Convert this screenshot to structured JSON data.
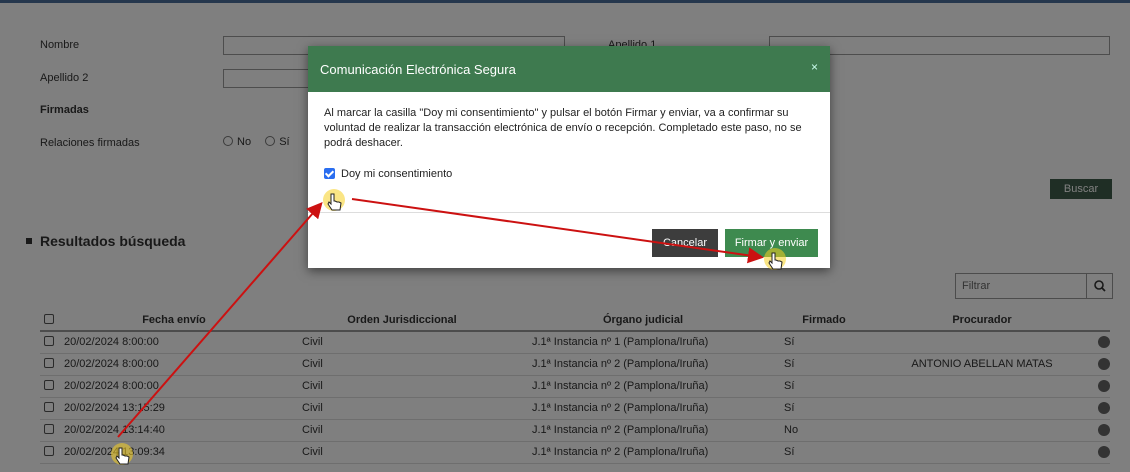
{
  "form": {
    "nombre_label": "Nombre",
    "apellido1_label": "Apellido 1",
    "apellido2_label": "Apellido 2",
    "firmadas_label": "Firmadas",
    "relaciones_label": "Relaciones firmadas",
    "radio_no": "No",
    "radio_si": "Sí",
    "buscar_label": "Buscar"
  },
  "results": {
    "title": "Resultados búsqueda",
    "filter_placeholder": "Filtrar",
    "columns": [
      "Fecha envío",
      "Orden Jurisdiccional",
      "Órgano judicial",
      "Firmado",
      "Procurador"
    ],
    "rows": [
      {
        "fecha": "20/02/2024 8:00:00",
        "orden": "Civil",
        "organo": "J.1ª Instancia nº 1 (Pamplona/Iruña)",
        "firmado": "Sí",
        "procurador": ""
      },
      {
        "fecha": "20/02/2024 8:00:00",
        "orden": "Civil",
        "organo": "J.1ª Instancia nº 2 (Pamplona/Iruña)",
        "firmado": "Sí",
        "procurador": "ANTONIO ABELLAN MATAS"
      },
      {
        "fecha": "20/02/2024 8:00:00",
        "orden": "Civil",
        "organo": "J.1ª Instancia nº 2 (Pamplona/Iruña)",
        "firmado": "Sí",
        "procurador": ""
      },
      {
        "fecha": "20/02/2024 13:15:29",
        "orden": "Civil",
        "organo": "J.1ª Instancia nº 2 (Pamplona/Iruña)",
        "firmado": "Sí",
        "procurador": ""
      },
      {
        "fecha": "20/02/2024 13:14:40",
        "orden": "Civil",
        "organo": "J.1ª Instancia nº 2 (Pamplona/Iruña)",
        "firmado": "No",
        "procurador": ""
      },
      {
        "fecha": "20/02/2024 13:09:34",
        "orden": "Civil",
        "organo": "J.1ª Instancia nº 2 (Pamplona/Iruña)",
        "firmado": "Sí",
        "procurador": ""
      }
    ]
  },
  "modal": {
    "title": "Comunicación Electrónica Segura",
    "close": "×",
    "body": "Al marcar la casilla \"Doy mi consentimiento\" y pulsar el botón Firmar y enviar, va a confirmar su voluntad de realizar la transacción electrónica de envío o recepción. Completado este paso, no se podrá deshacer.",
    "consent_label": "Doy mi consentimiento",
    "consent_checked": true,
    "cancel_label": "Cancelar",
    "submit_label": "Firmar y enviar"
  },
  "colors": {
    "modal_header": "#3e7a4f",
    "submit_button": "#3e8a4f",
    "annotation_arrow": "#cc1111"
  },
  "icons": [
    "close-icon",
    "search-icon",
    "more-options-icon",
    "hand-cursor-icon",
    "arrow-annotation"
  ]
}
